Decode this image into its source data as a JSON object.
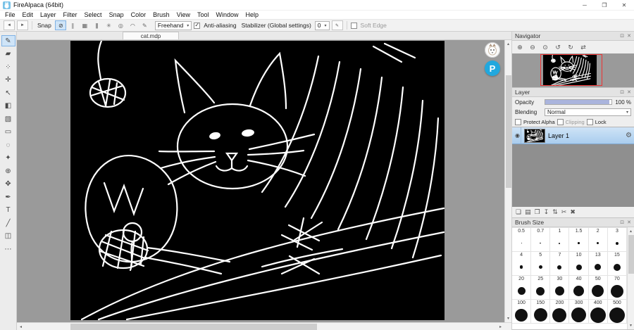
{
  "window": {
    "title": "FireAlpaca (64bit)",
    "minimize": "─",
    "maximize": "❐",
    "close": "✕"
  },
  "menu": {
    "items": [
      "File",
      "Edit",
      "Layer",
      "Filter",
      "Select",
      "Snap",
      "Color",
      "Brush",
      "View",
      "Tool",
      "Window",
      "Help"
    ]
  },
  "toolbar": {
    "undo": "◄",
    "redo": "►",
    "snap_label": "Snap",
    "snap": [
      {
        "name": "snap-off",
        "glyph": "⊘"
      },
      {
        "name": "snap-parallel",
        "glyph": "∥"
      },
      {
        "name": "snap-crosshatch",
        "glyph": "▦"
      },
      {
        "name": "snap-vertical",
        "glyph": "|||"
      },
      {
        "name": "snap-radial",
        "glyph": "✳"
      },
      {
        "name": "snap-circle",
        "glyph": "◎"
      },
      {
        "name": "snap-curve",
        "glyph": "◠"
      },
      {
        "name": "snap-settings",
        "glyph": "✎"
      }
    ],
    "brush_type": "Freehand",
    "dropdown_arrow": "▾",
    "check": "✓",
    "anti_aliasing": "Anti-aliasing",
    "stabilizer": "Stabilizer (Global settings)",
    "stabilizer_value": "0",
    "soft_edge": "Soft Edge"
  },
  "tools": [
    {
      "name": "pen",
      "glyph": "✎"
    },
    {
      "name": "eraser",
      "glyph": "▰"
    },
    {
      "name": "dot",
      "glyph": "⁘"
    },
    {
      "name": "move",
      "glyph": "✛"
    },
    {
      "name": "select-move",
      "glyph": "↖"
    },
    {
      "name": "fill",
      "glyph": "◧"
    },
    {
      "name": "gradient",
      "glyph": "▧"
    },
    {
      "name": "select-rect",
      "glyph": "▭"
    },
    {
      "name": "lasso",
      "glyph": "◌"
    },
    {
      "name": "magic-wand",
      "glyph": "✦"
    },
    {
      "name": "zoom",
      "glyph": "⊕"
    },
    {
      "name": "hand",
      "glyph": "✥"
    },
    {
      "name": "eyedropper",
      "glyph": "✒"
    },
    {
      "name": "text",
      "glyph": "T"
    },
    {
      "name": "line",
      "glyph": "╱"
    },
    {
      "name": "divide",
      "glyph": "◫"
    },
    {
      "name": "more",
      "glyph": "⋯"
    }
  ],
  "canvas": {
    "tab": "cat.mdp"
  },
  "badges": {
    "p": "P"
  },
  "scroll": {
    "left": "◂",
    "right": "▸",
    "up": "▴",
    "down": "▾"
  },
  "panel_icons": {
    "dock": "⊡",
    "close": "✕"
  },
  "navigator": {
    "title": "Navigator",
    "zoom_in": "⊕",
    "zoom_out": "⊖",
    "zoom_fit": "⊙",
    "rotate_ccw": "↺",
    "rotate_cw": "↻",
    "flip": "⇄"
  },
  "layer_panel": {
    "title": "Layer",
    "opacity_label": "Opacity",
    "opacity_value": "100 %",
    "blending_label": "Blending",
    "blending_value": "Normal",
    "dropdown_arrow": "▾",
    "protect_alpha": "Protect Alpha",
    "clipping": "Clipping",
    "lock": "Lock",
    "eye": "◉",
    "layer_name": "Layer 1",
    "gear": "⚙",
    "buttons": [
      {
        "name": "add-layer",
        "glyph": "❏"
      },
      {
        "name": "add-folder",
        "glyph": "▤"
      },
      {
        "name": "duplicate-layer",
        "glyph": "❐"
      },
      {
        "name": "merge-down",
        "glyph": "↧"
      },
      {
        "name": "reorder-layer",
        "glyph": "⇅"
      },
      {
        "name": "clear-layer",
        "glyph": "✂"
      },
      {
        "name": "delete-layer",
        "glyph": "✖"
      }
    ]
  },
  "brush_size": {
    "title": "Brush Size",
    "sizes": [
      "0.5",
      "0.7",
      "1",
      "1.5",
      "2",
      "3",
      "4",
      "5",
      "7",
      "10",
      "13",
      "15",
      "20",
      "25",
      "30",
      "40",
      "50",
      "70",
      "100",
      "150",
      "200",
      "300",
      "400",
      "500"
    ]
  },
  "colors": {
    "accent": "#7fb2e5",
    "p_badge": "#21a8de",
    "viewport_red": "#ee3333",
    "canvas_bg": "#000000"
  }
}
